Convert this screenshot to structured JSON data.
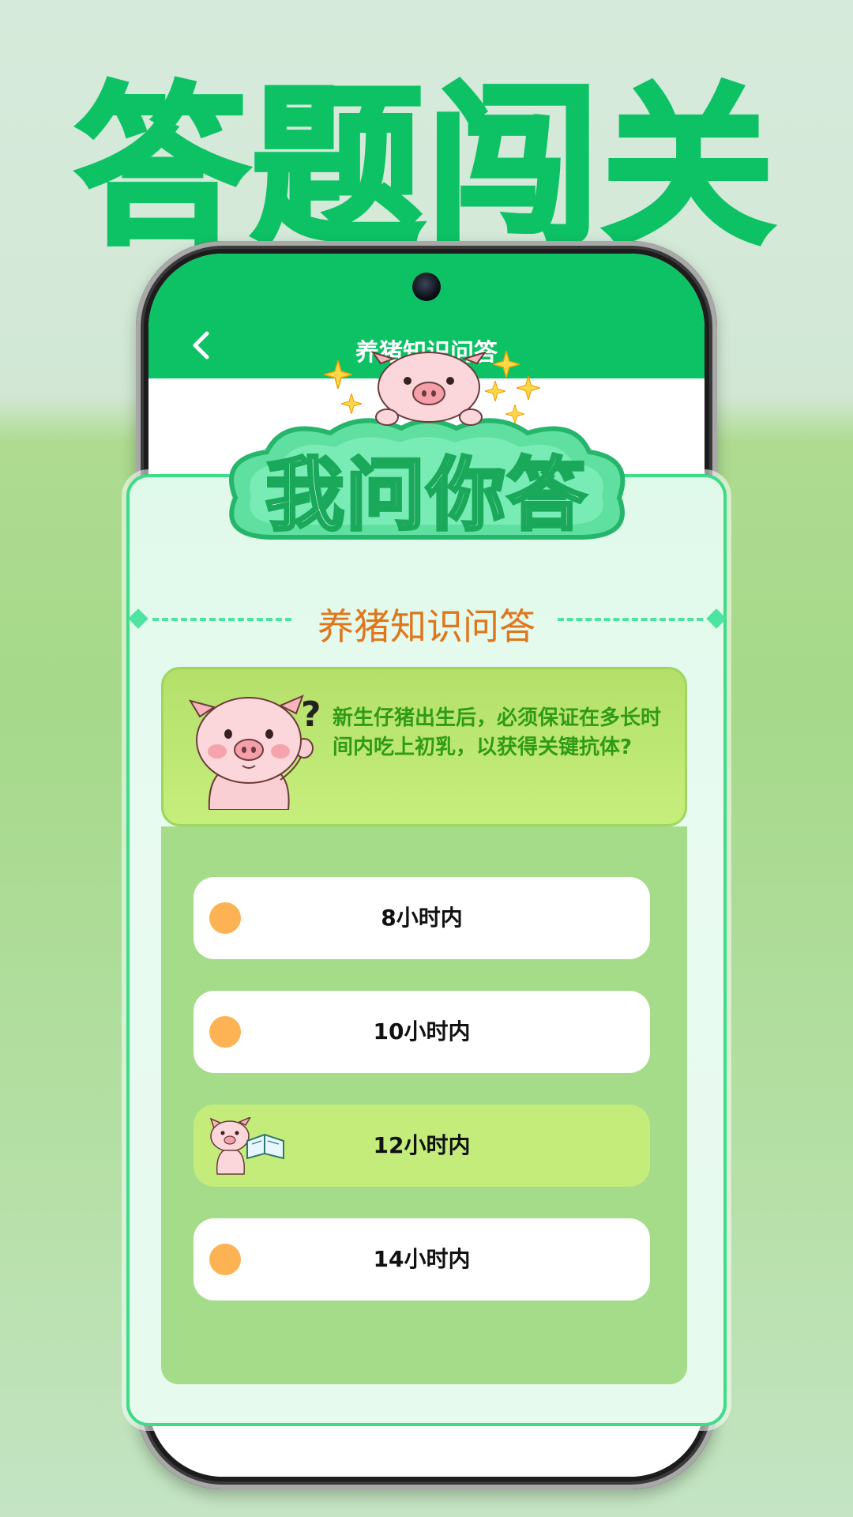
{
  "hero": {
    "title": "答题闯关"
  },
  "app_bar": {
    "title": "养猪知识问答",
    "back_icon": "chevron-left-icon"
  },
  "badge": {
    "text": "我问你答"
  },
  "quiz": {
    "section_title": "养猪知识问答",
    "question": "新生仔猪出生后，必须保证在多长时间内吃上初乳，以获得关键抗体?",
    "options": [
      {
        "label": "8小时内",
        "selected": false
      },
      {
        "label": "10小时内",
        "selected": false
      },
      {
        "label": "12小时内",
        "selected": true
      },
      {
        "label": "14小时内",
        "selected": false
      }
    ]
  },
  "colors": {
    "brand_green": "#0dc265",
    "section_title": "#e0761c",
    "question_text": "#2f9b16",
    "option_dot": "#fdb354",
    "selected_option": "#c3ec7a"
  }
}
